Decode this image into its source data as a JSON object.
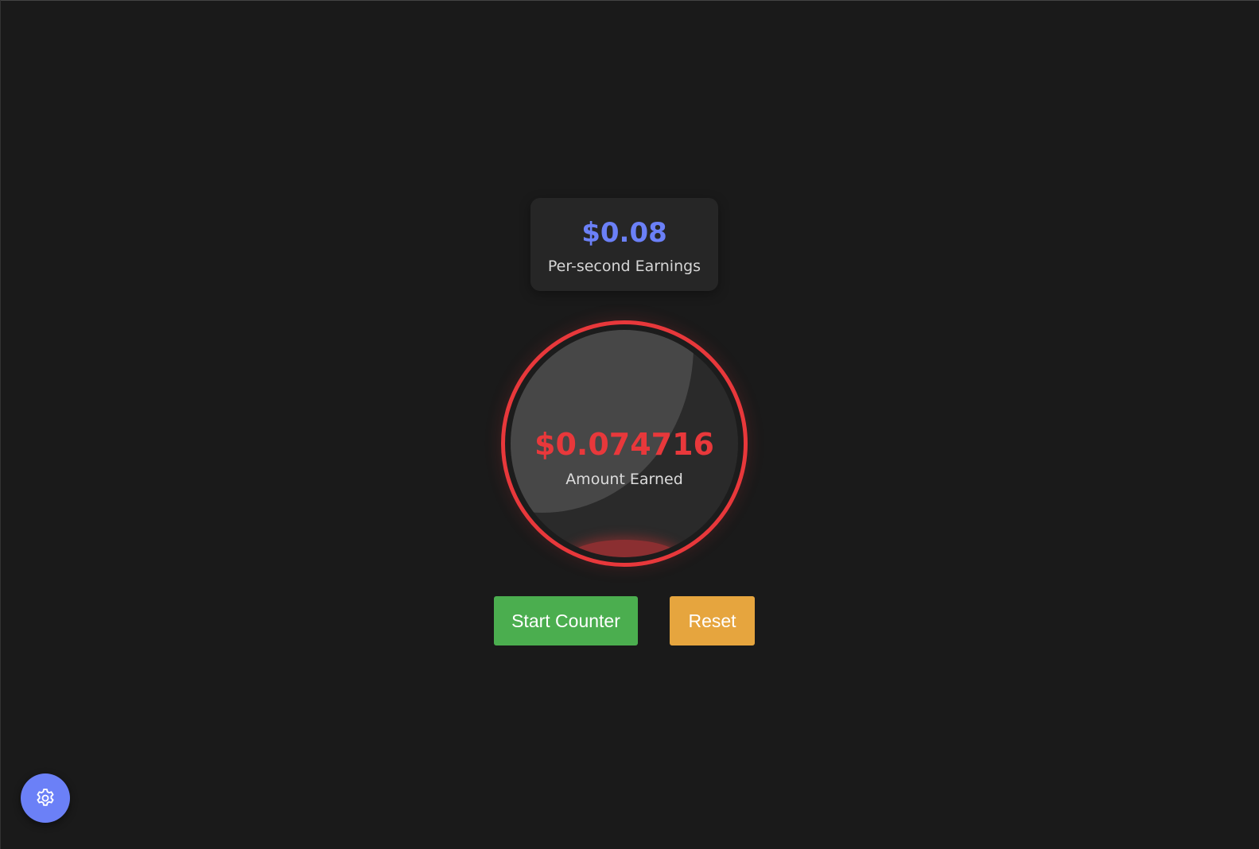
{
  "rate": {
    "value": "$0.08",
    "label": "Per-second Earnings"
  },
  "counter": {
    "amount": "$0.074716",
    "label": "Amount Earned"
  },
  "controls": {
    "start_label": "Start Counter",
    "reset_label": "Reset"
  },
  "settings": {
    "icon": "gear-icon"
  },
  "colors": {
    "background": "#1a1a1a",
    "card": "#262626",
    "rate_accent": "#6b80f7",
    "amount_accent": "#e8383b",
    "start_button": "#4bae4f",
    "reset_button": "#e6a53e",
    "settings_button": "#6b80f7"
  }
}
